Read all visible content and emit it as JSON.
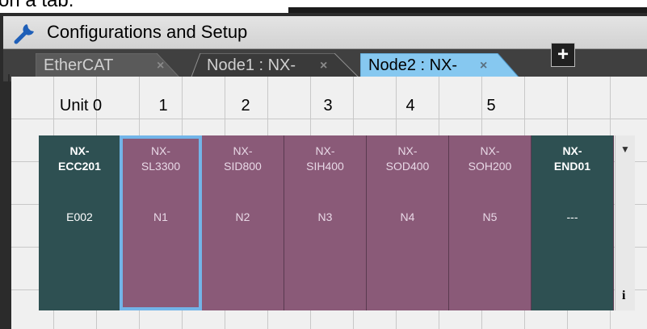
{
  "window": {
    "title": "Configurations and Setup",
    "title_icon": "wrench-icon"
  },
  "tabs": [
    {
      "label": "EtherCAT",
      "close": "×",
      "active": false
    },
    {
      "label": "Node1 : NX-",
      "close": "×",
      "active": false
    },
    {
      "label": "Node2 : NX-",
      "close": "×",
      "active": true
    }
  ],
  "add_tab": {
    "label": "+",
    "icon": "plus-icon"
  },
  "units": [
    {
      "number": "Unit 0",
      "model_line1": "NX-",
      "model_line2": "ECC201",
      "node": "E002",
      "kind": "coupler"
    },
    {
      "number": "1",
      "model_line1": "NX-",
      "model_line2": "SL3300",
      "node": "N1",
      "kind": "slice",
      "selected": true
    },
    {
      "number": "2",
      "model_line1": "NX-",
      "model_line2": "SID800",
      "node": "N2",
      "kind": "slice"
    },
    {
      "number": "3",
      "model_line1": "NX-",
      "model_line2": "SIH400",
      "node": "N3",
      "kind": "slice"
    },
    {
      "number": "4",
      "model_line1": "NX-",
      "model_line2": "SOD400",
      "node": "N4",
      "kind": "slice"
    },
    {
      "number": "5",
      "model_line1": "NX-",
      "model_line2": "SOH200",
      "node": "N5",
      "kind": "slice"
    },
    {
      "number": "",
      "model_line1": "NX-",
      "model_line2": "END01",
      "node": "---",
      "kind": "endcover"
    }
  ],
  "scroll": {
    "down_arrow": "▼",
    "info_label": "i"
  },
  "fragment": {
    "text": "on a tab."
  },
  "colors": {
    "coupler": "#2e5052",
    "slice": "#8a5a78",
    "selected_border": "#72b4e8",
    "active_tab": "#86c8f0"
  }
}
